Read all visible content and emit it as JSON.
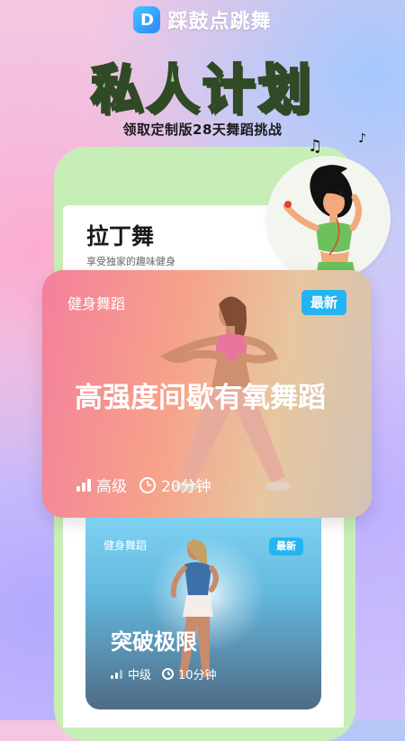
{
  "brand": {
    "logo_letter": "D",
    "name": "踩鼓点跳舞"
  },
  "hero": {
    "title": "私人计划",
    "subtitle": "领取定制版28天舞蹈挑战"
  },
  "phone": {
    "title": "拉丁舞",
    "subtitle": "享受独家的趣味健身"
  },
  "featured_card": {
    "tag": "健身舞蹈",
    "badge": "最新",
    "title": "高强度间歇有氧舞蹈",
    "level": "高级",
    "duration": "20分钟"
  },
  "second_card": {
    "tag": "健身舞蹈",
    "badge": "最新",
    "title": "突破极限",
    "level": "中级",
    "duration": "10分钟"
  },
  "decor": {
    "music_note": "♫",
    "music_note_small": "♪"
  },
  "colors": {
    "accent": "#25b4f2",
    "hero_green": "#8edb7a",
    "phone_frame": "#c8eeb7"
  }
}
